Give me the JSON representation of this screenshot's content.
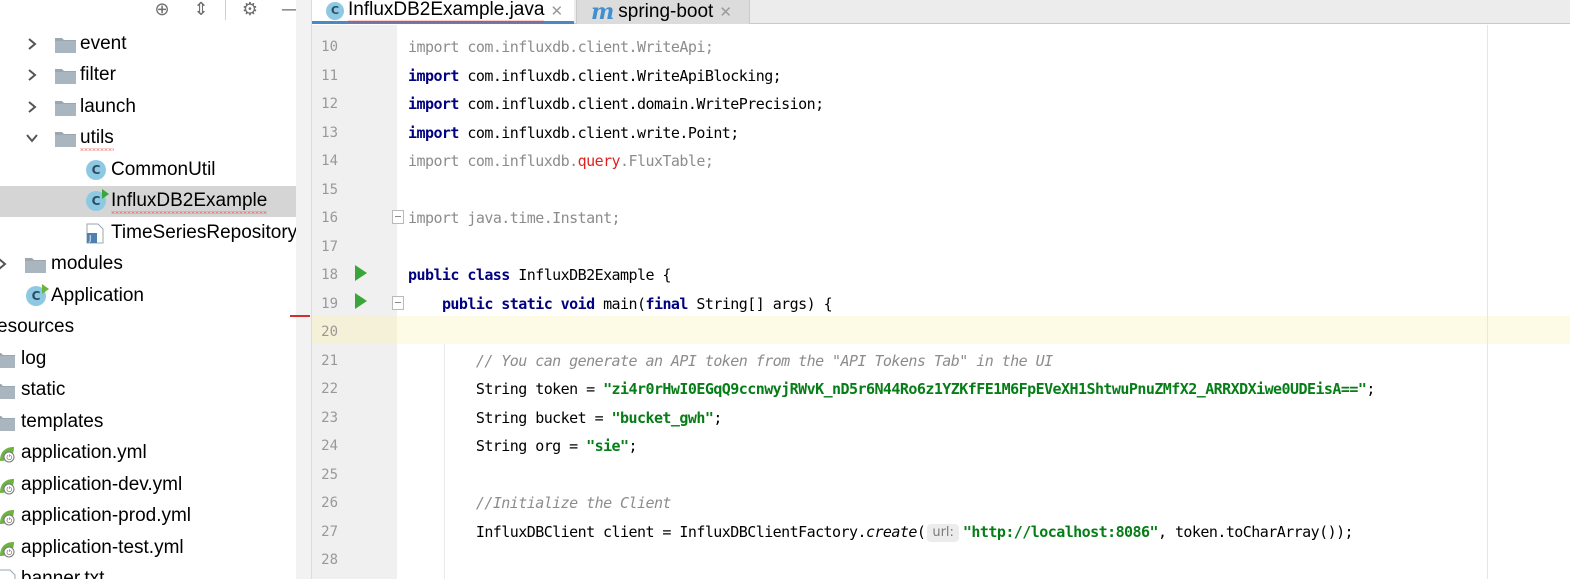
{
  "project": {
    "tree": [
      {
        "label": "event",
        "kind": "folder",
        "expanded": false
      },
      {
        "label": "filter",
        "kind": "folder",
        "expanded": false
      },
      {
        "label": "launch",
        "kind": "folder",
        "expanded": false
      },
      {
        "label": "utils",
        "kind": "folder",
        "expanded": true
      },
      {
        "label": "CommonUtil",
        "kind": "class"
      },
      {
        "label": "InfluxDB2Example",
        "kind": "class-runnable",
        "selected": true
      },
      {
        "label": "TimeSeriesRepository.ja",
        "kind": "java-file"
      },
      {
        "label": "modules",
        "kind": "folder",
        "expanded": false
      },
      {
        "label": "Application",
        "kind": "spring-app"
      },
      {
        "label": "esources",
        "kind": "folder-partial"
      },
      {
        "label": "log",
        "kind": "folder"
      },
      {
        "label": "static",
        "kind": "folder"
      },
      {
        "label": "templates",
        "kind": "folder"
      },
      {
        "label": "application.yml",
        "kind": "spring-config"
      },
      {
        "label": "application-dev.yml",
        "kind": "spring-config"
      },
      {
        "label": "application-prod.yml",
        "kind": "spring-config"
      },
      {
        "label": "application-test.yml",
        "kind": "spring-config"
      },
      {
        "label": "banner.txt",
        "kind": "text-file"
      }
    ],
    "toolbar_icons": [
      "locate-icon",
      "collapse-all-icon",
      "settings-icon",
      "hide-icon"
    ]
  },
  "tabs": [
    {
      "label": "InfluxDB2Example.java",
      "icon": "class-icon",
      "active": true
    },
    {
      "label": "spring-boot",
      "icon": "maven-icon",
      "active": false
    }
  ],
  "editor": {
    "current_line": 20,
    "inlay_hint": "url:",
    "lines": [
      {
        "n": "10",
        "parts": [
          [
            "kw-unused",
            "import"
          ],
          [
            "unused",
            " com.influxdb.client.WriteApi;"
          ]
        ]
      },
      {
        "n": "11",
        "parts": [
          [
            "kw",
            "import"
          ],
          [
            "plain",
            " com.influxdb.client.WriteApiBlocking;"
          ]
        ]
      },
      {
        "n": "12",
        "parts": [
          [
            "kw",
            "import"
          ],
          [
            "plain",
            " com.influxdb.client.domain.WritePrecision;"
          ]
        ]
      },
      {
        "n": "13",
        "parts": [
          [
            "kw",
            "import"
          ],
          [
            "plain",
            " com.influxdb.client.write.Point;"
          ]
        ]
      },
      {
        "n": "14",
        "parts": [
          [
            "kw-unused",
            "import"
          ],
          [
            "unused",
            " com.influxdb."
          ],
          [
            "err",
            "query"
          ],
          [
            "unused",
            ".FluxTable;"
          ]
        ]
      },
      {
        "n": "15",
        "parts": []
      },
      {
        "n": "16",
        "parts": [
          [
            "kw-unused",
            "import"
          ],
          [
            "unused",
            " java.time.Instant;"
          ]
        ]
      },
      {
        "n": "17",
        "parts": []
      },
      {
        "n": "18",
        "parts": [
          [
            "kw",
            "public class"
          ],
          [
            "plain",
            " InfluxDB2Example {"
          ]
        ]
      },
      {
        "n": "19",
        "parts": [
          [
            "plain",
            "    "
          ],
          [
            "kw",
            "public static void"
          ],
          [
            "plain",
            " main("
          ],
          [
            "kw",
            "final"
          ],
          [
            "plain",
            " String[] args) {"
          ]
        ]
      },
      {
        "n": "20",
        "parts": []
      },
      {
        "n": "21",
        "parts": [
          [
            "plain",
            "        "
          ],
          [
            "cmt",
            "// You can generate an API token from the \"API Tokens Tab\" in the UI"
          ]
        ]
      },
      {
        "n": "22",
        "parts": [
          [
            "plain",
            "        String token = "
          ],
          [
            "str",
            "\"zi4r0rHwI0EGqQ9ccnwyjRWvK_nD5r6N44Ro6z1YZKfFE1M6FpEVeXH1ShtwuPnuZMfX2_ARRXDXiwe0UDEisA==\""
          ],
          [
            "plain",
            ";"
          ]
        ]
      },
      {
        "n": "23",
        "parts": [
          [
            "plain",
            "        String bucket = "
          ],
          [
            "str",
            "\"bucket_gwh\""
          ],
          [
            "plain",
            ";"
          ]
        ]
      },
      {
        "n": "24",
        "parts": [
          [
            "plain",
            "        String org = "
          ],
          [
            "str",
            "\"sie\""
          ],
          [
            "plain",
            ";"
          ]
        ]
      },
      {
        "n": "25",
        "parts": []
      },
      {
        "n": "26",
        "parts": [
          [
            "plain",
            "        "
          ],
          [
            "cmt",
            "//Initialize the Client"
          ]
        ]
      },
      {
        "n": "27",
        "parts": [
          [
            "plain",
            "        InfluxDBClient client = InfluxDBClientFactory."
          ],
          [
            "italic",
            "create"
          ],
          [
            "plain",
            "("
          ],
          [
            "hint",
            "url:"
          ],
          [
            "str",
            "\"http://localhost:8086\""
          ],
          [
            "plain",
            ", token.toCharArray());"
          ]
        ]
      },
      {
        "n": "28",
        "parts": []
      }
    ]
  },
  "colors": {
    "keyword": "#000080",
    "string": "#067d17",
    "comment": "#8c8c8c",
    "error": "#e0211d",
    "selection": "#d5d5d5",
    "current_line": "#fdfbe6",
    "run_icon": "#3aa53a"
  }
}
